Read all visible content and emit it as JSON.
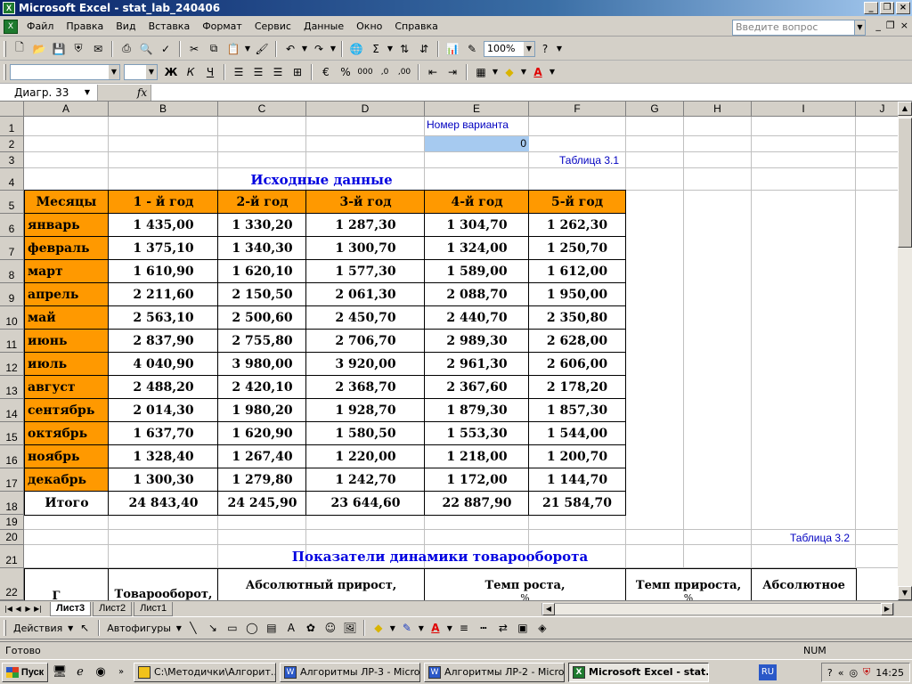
{
  "window": {
    "title": "Microsoft Excel - stat_lab_240406",
    "app_icon": "excel-icon"
  },
  "menu": {
    "items": [
      "Файл",
      "Правка",
      "Вид",
      "Вставка",
      "Формат",
      "Сервис",
      "Данные",
      "Окно",
      "Справка"
    ],
    "help_placeholder": "Введите вопрос"
  },
  "toolbar": {
    "zoom": "100%"
  },
  "formula_bar": {
    "name_box": "Диагр. 33",
    "fx_label": "fx",
    "content": ""
  },
  "grid": {
    "columns": [
      "A",
      "B",
      "C",
      "D",
      "E",
      "F",
      "G",
      "H",
      "I",
      "J"
    ],
    "rows": [
      "1",
      "2",
      "3",
      "4",
      "5",
      "6",
      "7",
      "8",
      "9",
      "10",
      "11",
      "12",
      "13",
      "14",
      "15",
      "16",
      "17",
      "18",
      "19",
      "20",
      "21",
      "22"
    ]
  },
  "sheet": {
    "variant_label": "Номер варианта",
    "variant_value": "0",
    "table1_caption": "Таблица 3.1",
    "table1_title": "Исходные данные",
    "table1_headers": [
      "Месяцы",
      "1 - й год",
      "2-й год",
      "3-й год",
      "4-й год",
      "5-й год"
    ],
    "table1_rows": [
      [
        "январь",
        "1 435,00",
        "1 330,20",
        "1 287,30",
        "1 304,70",
        "1 262,30"
      ],
      [
        "февраль",
        "1 375,10",
        "1 340,30",
        "1 300,70",
        "1 324,00",
        "1 250,70"
      ],
      [
        "март",
        "1 610,90",
        "1 620,10",
        "1 577,30",
        "1 589,00",
        "1 612,00"
      ],
      [
        "апрель",
        "2 211,60",
        "2 150,50",
        "2 061,30",
        "2 088,70",
        "1 950,00"
      ],
      [
        "май",
        "2 563,10",
        "2 500,60",
        "2 450,70",
        "2 440,70",
        "2 350,80"
      ],
      [
        "июнь",
        "2 837,90",
        "2 755,80",
        "2 706,70",
        "2 989,30",
        "2 628,00"
      ],
      [
        "июль",
        "4 040,90",
        "3 980,00",
        "3 920,00",
        "2 961,30",
        "2 606,00"
      ],
      [
        "август",
        "2 488,20",
        "2 420,10",
        "2 368,70",
        "2 367,60",
        "2 178,20"
      ],
      [
        "сентябрь",
        "2 014,30",
        "1 980,20",
        "1 928,70",
        "1 879,30",
        "1 857,30"
      ],
      [
        "октябрь",
        "1 637,70",
        "1 620,90",
        "1 580,50",
        "1 553,30",
        "1 544,00"
      ],
      [
        "ноябрь",
        "1 328,40",
        "1 267,40",
        "1 220,00",
        "1 218,00",
        "1 200,70"
      ],
      [
        "декабрь",
        "1 300,30",
        "1 279,80",
        "1 242,70",
        "1 172,00",
        "1 144,70"
      ]
    ],
    "table1_total": [
      "Итого",
      "24 843,40",
      "24 245,90",
      "23 644,60",
      "22 887,90",
      "21 584,70"
    ],
    "table2_caption": "Таблица 3.2",
    "table2_title": "Показатели динамики товарооборота",
    "table2_headers": [
      "Товарооборот,",
      "Абсолютный прирост,",
      "Темп роста,",
      "Темп прироста,",
      "Абсолютное"
    ],
    "table2_header_first_partial": "Г",
    "table2_header_units": [
      "%",
      "%"
    ]
  },
  "tabs": {
    "sheets": [
      "Лист3",
      "Лист2",
      "Лист1"
    ],
    "active": "Лист3"
  },
  "drawbar": {
    "actions_label": "Действия",
    "autoshapes_label": "Автофигуры"
  },
  "status": {
    "ready": "Готово",
    "num": "NUM"
  },
  "taskbar": {
    "start_label": "Пуск",
    "tasks": [
      {
        "label": "C:\\Методички\\Алгорит...",
        "icon": "folder-icon",
        "active": false
      },
      {
        "label": "Алгоритмы ЛР-3 - Micro...",
        "icon": "word-icon",
        "active": false
      },
      {
        "label": "Алгоритмы ЛР-2 - Micro...",
        "icon": "word-icon",
        "active": false
      },
      {
        "label": "Microsoft Excel - stat...",
        "icon": "excel-icon",
        "active": true
      }
    ],
    "lang": "RU",
    "clock": "14:25"
  },
  "colors": {
    "header_orange": "#ff9900",
    "heading_blue": "#0000e0",
    "selected_cell": "#a6caf0"
  }
}
